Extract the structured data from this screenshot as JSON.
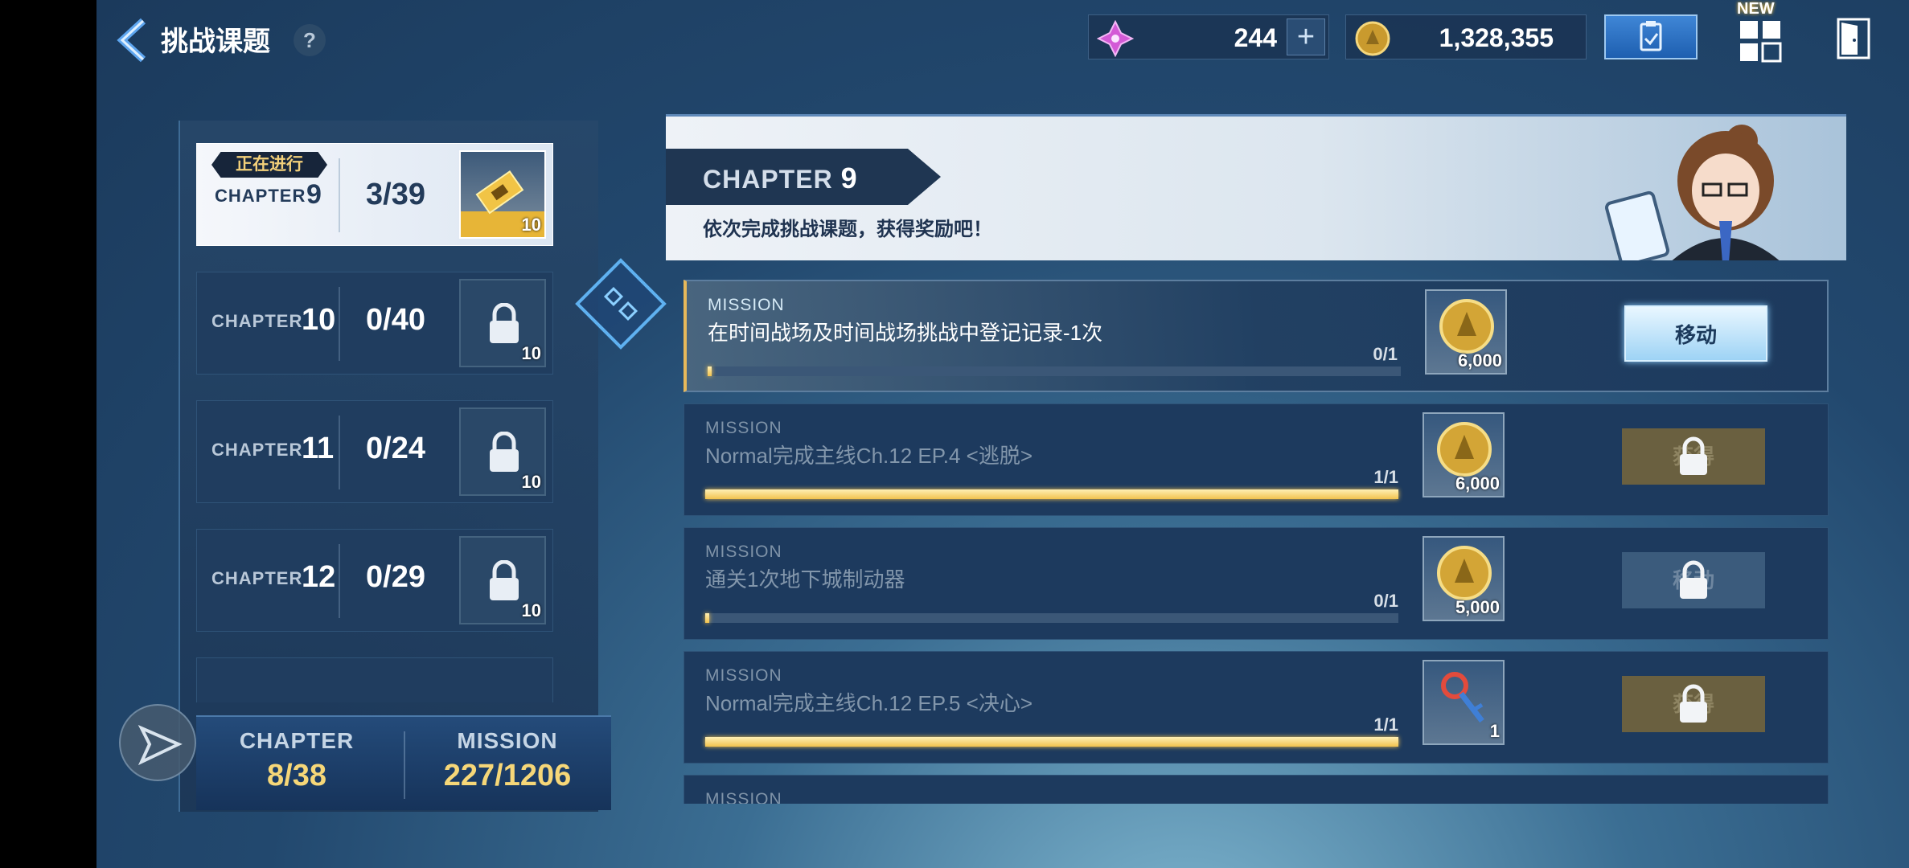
{
  "header": {
    "title": "挑战课题",
    "help": "?",
    "gem_value": "244",
    "coin_value": "1,328,355",
    "plus": "+",
    "new_tag": "NEW"
  },
  "chapters": [
    {
      "status": "正在进行",
      "label": "CHAPTER",
      "number": "9",
      "progress": "3/39",
      "reward_qty": "10",
      "active": true
    },
    {
      "label": "CHAPTER",
      "number": "10",
      "progress": "0/40",
      "reward_qty": "10"
    },
    {
      "label": "CHAPTER",
      "number": "11",
      "progress": "0/24",
      "reward_qty": "10"
    },
    {
      "label": "CHAPTER",
      "number": "12",
      "progress": "0/29",
      "reward_qty": "10"
    }
  ],
  "footer": {
    "chapter_label": "CHAPTER",
    "chapter_value": "8/38",
    "mission_label": "MISSION",
    "mission_value": "227/1206"
  },
  "banner": {
    "chapter_label": "CHAPTER",
    "chapter_number": "9",
    "description": "依次完成挑战课题，获得奖励吧！"
  },
  "missions": [
    {
      "label": "MISSION",
      "desc": "在时间战场及时间战场挑战中登记记录-1次",
      "count": "0/1",
      "progress": 0.0,
      "reward_qty": "6,000",
      "reward_type": "coin",
      "button": "移动",
      "button_state": "go"
    },
    {
      "label": "MISSION",
      "desc": "Normal完成主线Ch.12 EP.4 <逃脱>",
      "count": "1/1",
      "progress": 1.0,
      "reward_qty": "6,000",
      "reward_type": "coin",
      "button": "获得",
      "button_state": "locked-gold"
    },
    {
      "label": "MISSION",
      "desc": "通关1次地下城制动器",
      "count": "0/1",
      "progress": 0.0,
      "reward_qty": "5,000",
      "reward_type": "coin",
      "button": "移动",
      "button_state": "locked-blue"
    },
    {
      "label": "MISSION",
      "desc": "Normal完成主线Ch.12 EP.5 <决心>",
      "count": "1/1",
      "progress": 1.0,
      "reward_qty": "1",
      "reward_type": "key",
      "button": "获得",
      "button_state": "locked-gold"
    },
    {
      "label": "MISSION"
    }
  ],
  "colors": {
    "accent_gold": "#f2c24e",
    "panel_blue": "#1d3a5e",
    "go_button": "#9ed3f5"
  }
}
